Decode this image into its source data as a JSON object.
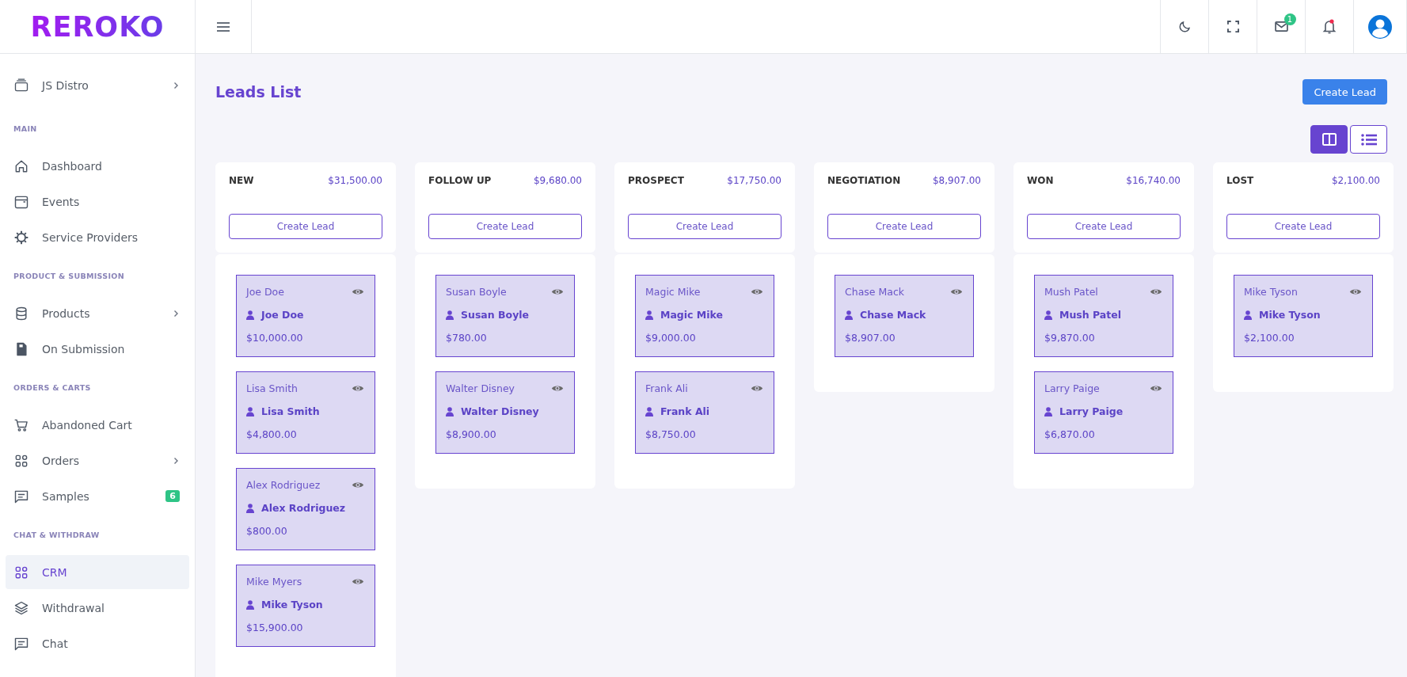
{
  "brand": {
    "logo": "REROKO"
  },
  "header": {
    "mail_badge": "1"
  },
  "sidebar": {
    "workspace": {
      "label": "JS Distro",
      "submenu": true
    },
    "sections": [
      {
        "title": "MAIN",
        "items": [
          {
            "label": "Dashboard",
            "submenu": false,
            "selected": false
          },
          {
            "label": "Events",
            "submenu": false,
            "selected": false
          },
          {
            "label": "Service Providers",
            "submenu": false,
            "selected": false
          }
        ]
      },
      {
        "title": "PRODUCT & SUBMISSION",
        "items": [
          {
            "label": "Products",
            "submenu": true,
            "selected": false
          },
          {
            "label": "On Submission",
            "submenu": false,
            "selected": false
          }
        ]
      },
      {
        "title": "ORDERS & CARTS",
        "items": [
          {
            "label": "Abandoned Cart",
            "submenu": false,
            "selected": false
          },
          {
            "label": "Orders",
            "submenu": true,
            "selected": false
          },
          {
            "label": "Samples",
            "submenu": false,
            "selected": false,
            "badge": "6"
          }
        ]
      },
      {
        "title": "CHAT & WITHDRAW",
        "items": [
          {
            "label": "CRM",
            "submenu": false,
            "selected": true
          },
          {
            "label": "Withdrawal",
            "submenu": false,
            "selected": false
          },
          {
            "label": "Chat",
            "submenu": false,
            "selected": false
          }
        ]
      }
    ]
  },
  "page": {
    "title": "Leads List",
    "create_button": "Create Lead",
    "views": [
      {
        "kind": "board",
        "selected": true
      },
      {
        "kind": "list",
        "selected": false
      }
    ]
  },
  "columns": [
    {
      "name": "NEW",
      "total": "$31,500.00",
      "button": "Create Lead",
      "leads": [
        {
          "title": "Joe Doe",
          "contact": "Joe Doe",
          "amount": "$10,000.00"
        },
        {
          "title": "Lisa Smith",
          "contact": "Lisa Smith",
          "amount": "$4,800.00"
        },
        {
          "title": "Alex Rodriguez",
          "contact": "Alex Rodriguez",
          "amount": "$800.00"
        },
        {
          "title": "Mike Myers",
          "contact": "Mike Tyson",
          "amount": "$15,900.00"
        }
      ]
    },
    {
      "name": "FOLLOW UP",
      "total": "$9,680.00",
      "button": "Create Lead",
      "leads": [
        {
          "title": "Susan Boyle",
          "contact": "Susan Boyle",
          "amount": "$780.00"
        },
        {
          "title": "Walter Disney",
          "contact": "Walter Disney",
          "amount": "$8,900.00"
        }
      ]
    },
    {
      "name": "PROSPECT",
      "total": "$17,750.00",
      "button": "Create Lead",
      "leads": [
        {
          "title": "Magic Mike",
          "contact": "Magic Mike",
          "amount": "$9,000.00"
        },
        {
          "title": "Frank Ali",
          "contact": "Frank Ali",
          "amount": "$8,750.00"
        }
      ]
    },
    {
      "name": "NEGOTIATION",
      "total": "$8,907.00",
      "button": "Create Lead",
      "leads": [
        {
          "title": "Chase Mack",
          "contact": "Chase Mack",
          "amount": "$8,907.00"
        }
      ]
    },
    {
      "name": "WON",
      "total": "$16,740.00",
      "button": "Create Lead",
      "leads": [
        {
          "title": "Mush Patel",
          "contact": "Mush Patel",
          "amount": "$9,870.00"
        },
        {
          "title": "Larry Paige",
          "contact": "Larry Paige",
          "amount": "$6,870.00"
        }
      ]
    },
    {
      "name": "LOST",
      "total": "$2,100.00",
      "button": "Create Lead",
      "leads": [
        {
          "title": "Mike Tyson",
          "contact": "Mike Tyson",
          "amount": "$2,100.00"
        }
      ]
    }
  ]
}
